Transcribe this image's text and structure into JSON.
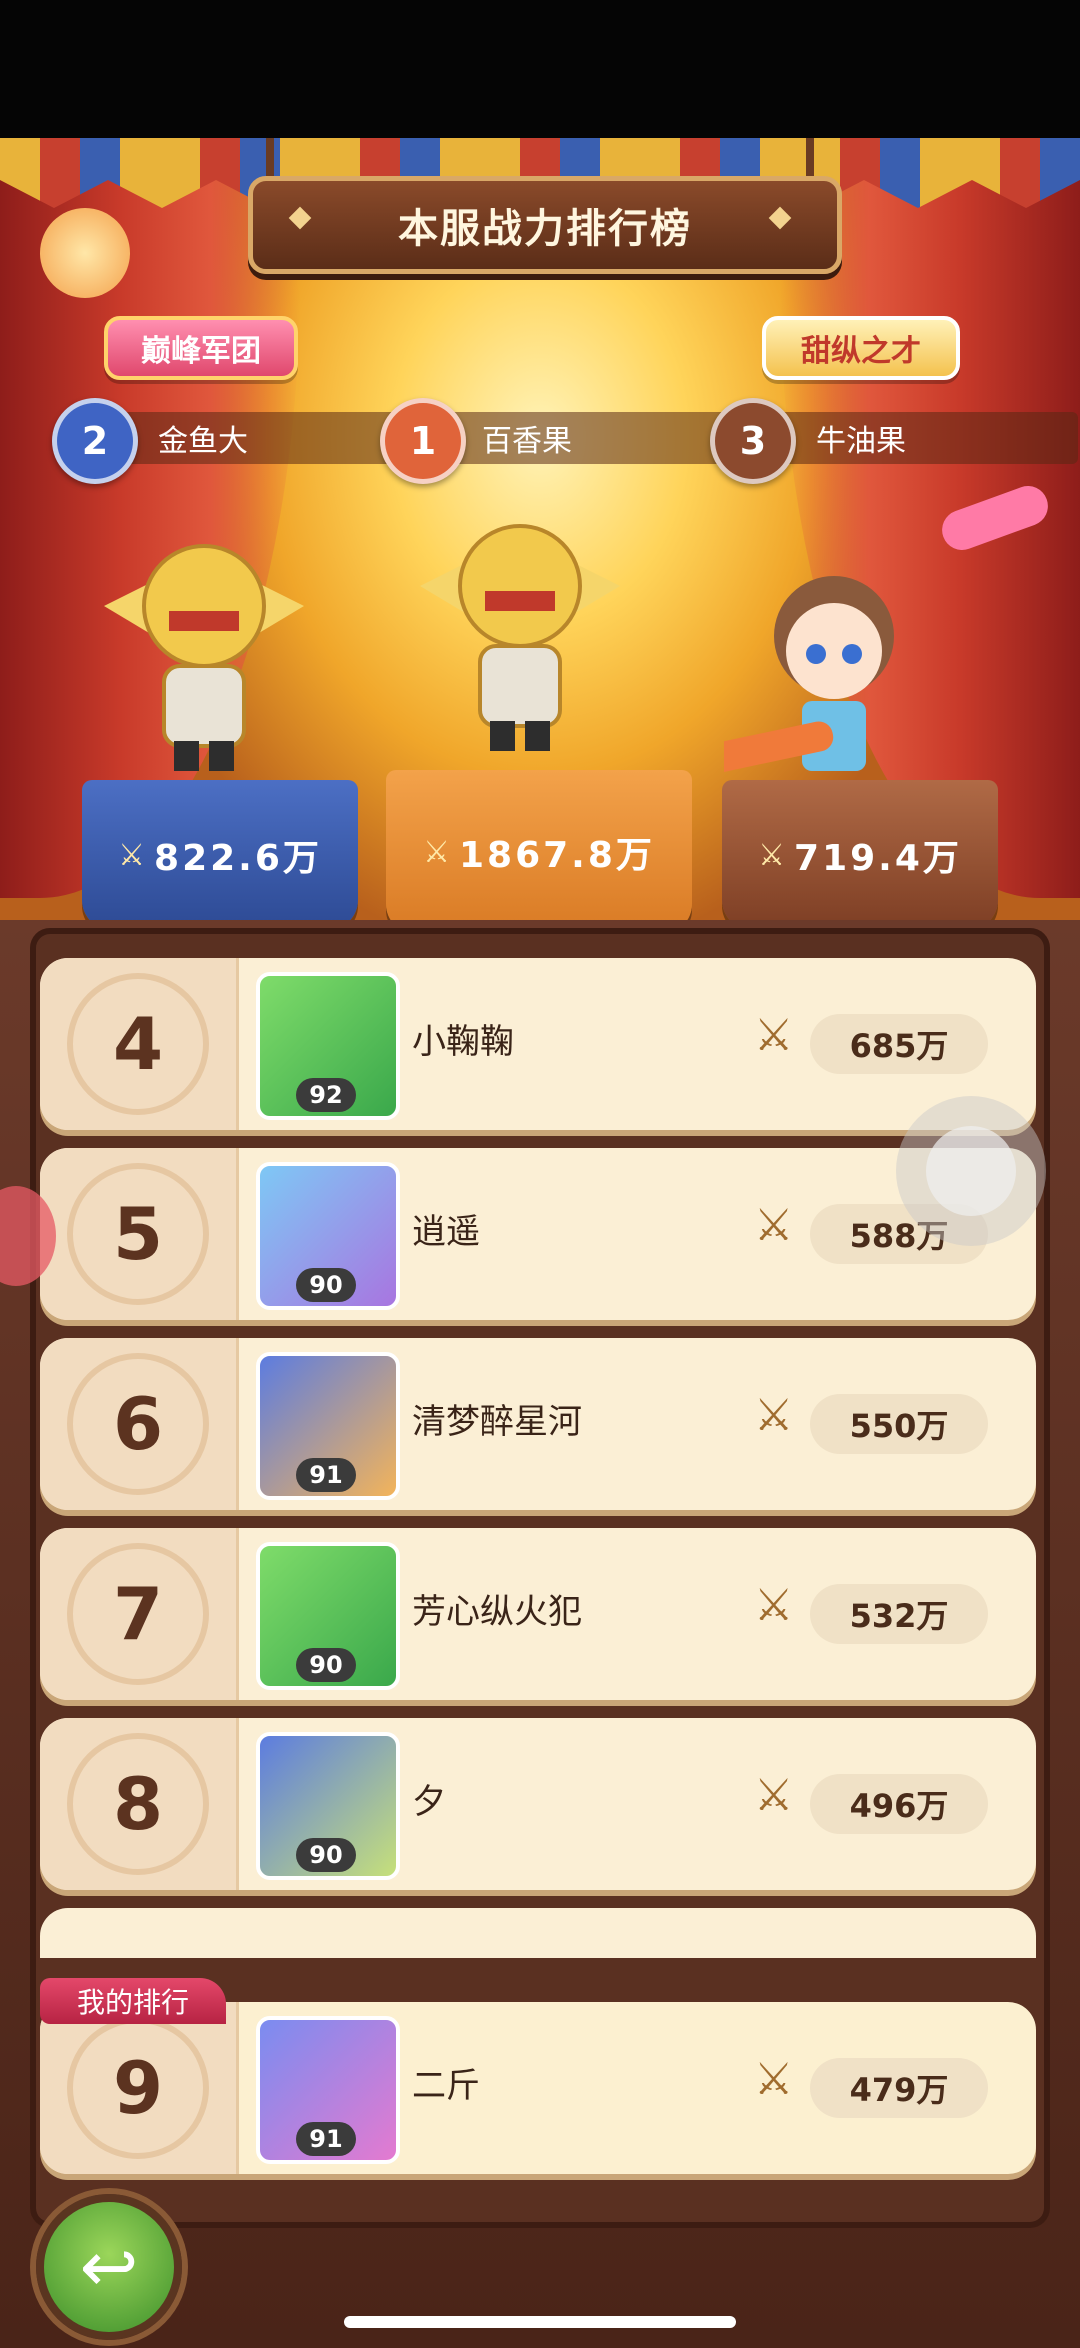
{
  "title": "本服战力排行榜",
  "tags": {
    "left": "巅峰军团",
    "right": "甜纵之才"
  },
  "podium": [
    {
      "rank": "2",
      "name": "金鱼大",
      "power": "822.6万",
      "color": "#3f64c4"
    },
    {
      "rank": "1",
      "name": "百香果",
      "power": "1867.8万",
      "color": "#e0643a"
    },
    {
      "rank": "3",
      "name": "牛油果",
      "power": "719.4万",
      "color": "#8c4a2e"
    }
  ],
  "rows": [
    {
      "rank": "4",
      "name": "小鞠鞠",
      "level": "92",
      "power": "685万"
    },
    {
      "rank": "5",
      "name": "逍遥",
      "level": "90",
      "power": "588万"
    },
    {
      "rank": "6",
      "name": "清梦醉星河",
      "level": "91",
      "power": "550万"
    },
    {
      "rank": "7",
      "name": "芳心纵火犯",
      "level": "90",
      "power": "532万"
    },
    {
      "rank": "8",
      "name": "夕",
      "level": "90",
      "power": "496万"
    }
  ],
  "my_rank": {
    "label": "我的排行",
    "rank": "9",
    "name": "二斤",
    "level": "91",
    "power": "479万"
  },
  "icons": {
    "sword": "crossed-swords-icon",
    "back": "back-arrow-icon"
  }
}
